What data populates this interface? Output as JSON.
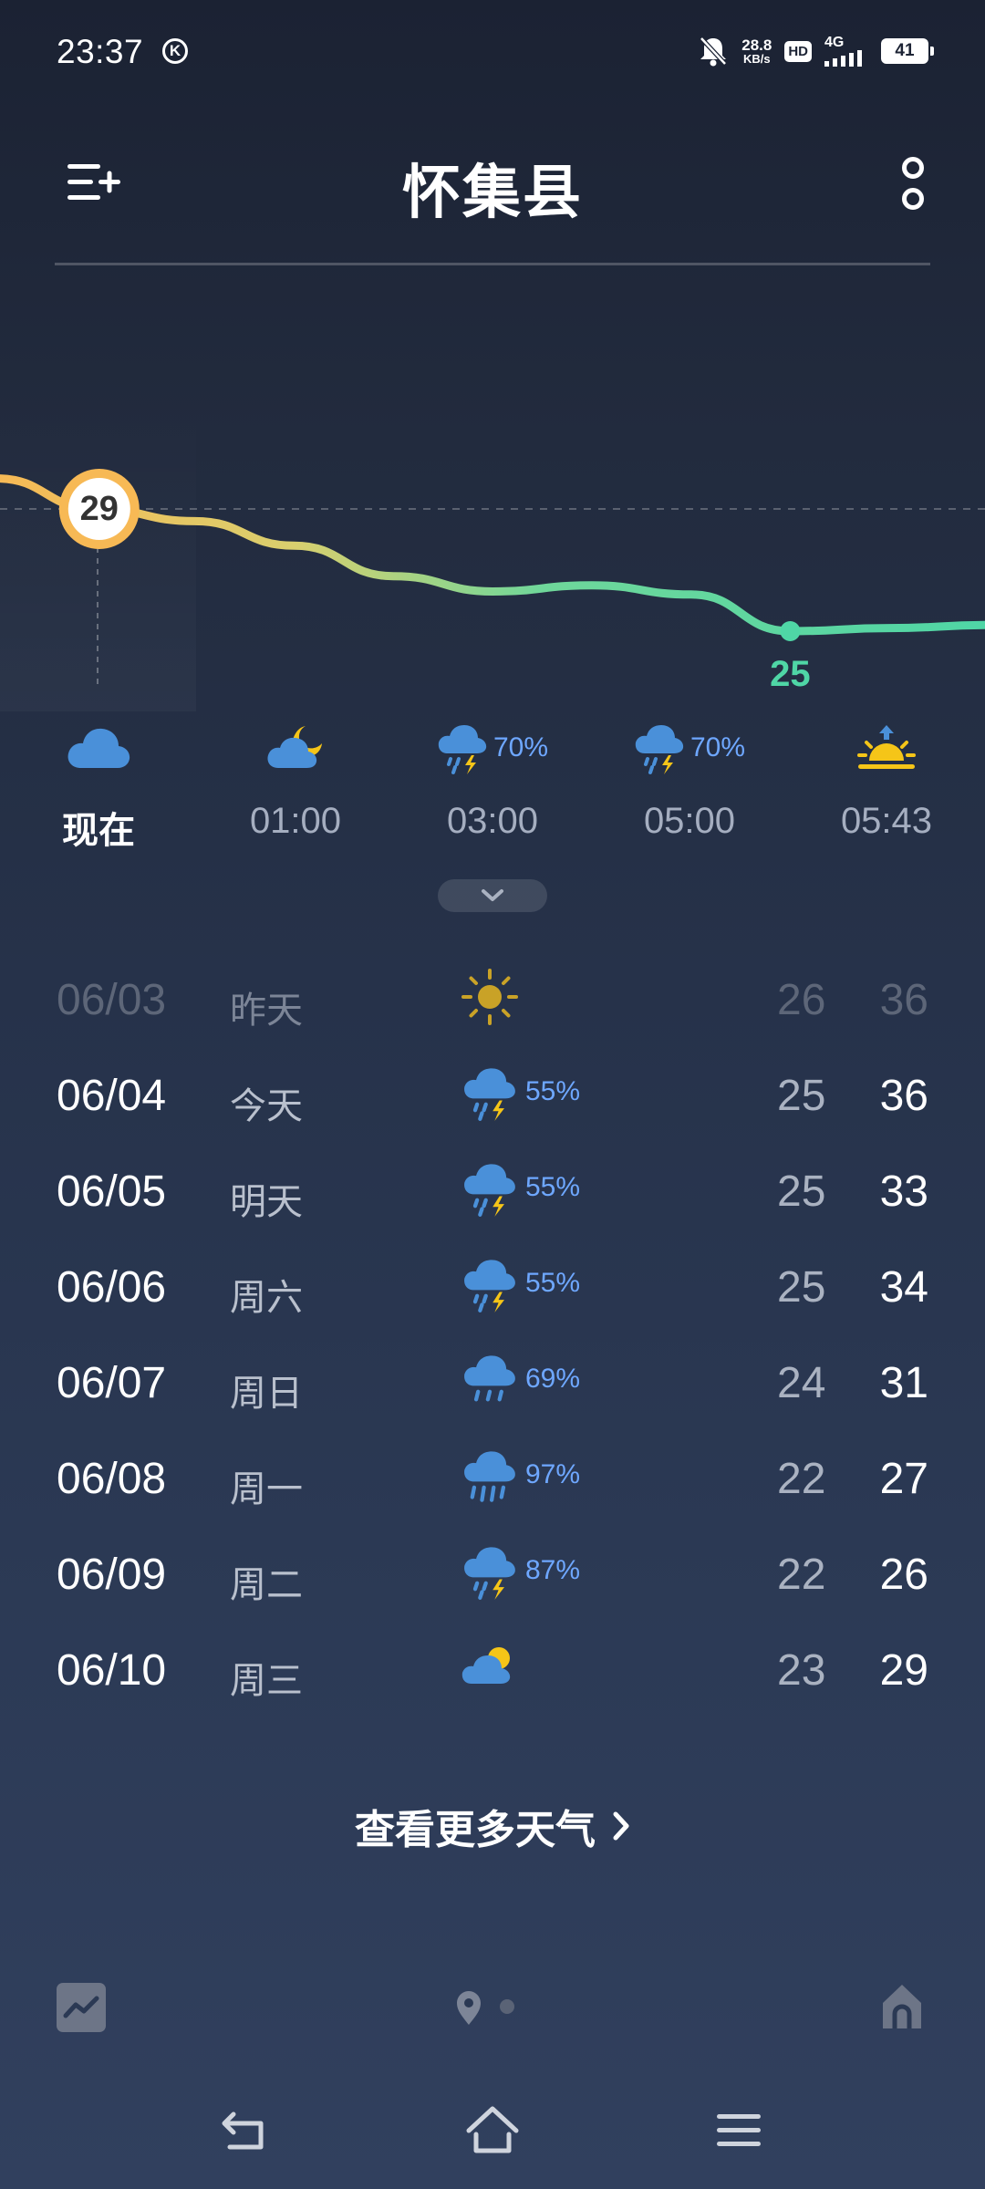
{
  "status_bar": {
    "time": "23:37",
    "k_badge": "K",
    "net_speed_value": "28.8",
    "net_speed_unit": "KB/s",
    "hd_label": "HD",
    "network_label": "4G",
    "battery_level": "41"
  },
  "header": {
    "city": "怀集县"
  },
  "chart_data": {
    "type": "line",
    "series": [
      {
        "values": [
          30,
          29,
          28.6,
          27.8,
          26.8,
          26.3,
          26.5,
          26.2,
          25,
          25.1,
          25.2
        ]
      }
    ],
    "labeled_points": [
      {
        "label": "29",
        "value": 29,
        "highlighted": true
      },
      {
        "label": "25",
        "value": 25,
        "highlighted": false
      }
    ],
    "colors": {
      "warm": "#f7b955",
      "mid": "#c9d777",
      "cool": "#57d6a2"
    },
    "grid": false
  },
  "hourly": [
    {
      "label": "现在",
      "icon": "cloudy-icon",
      "precip": ""
    },
    {
      "label": "01:00",
      "icon": "cloudy-night-icon",
      "precip": ""
    },
    {
      "label": "03:00",
      "icon": "thunder-shower-icon",
      "precip": "70%"
    },
    {
      "label": "05:00",
      "icon": "thunder-shower-icon",
      "precip": "70%"
    },
    {
      "label": "05:43",
      "icon": "sunrise-icon",
      "precip": ""
    }
  ],
  "daily": [
    {
      "date": "06/03",
      "weekday": "昨天",
      "icon": "sunny-icon",
      "precip": "",
      "low": "26",
      "high": "36"
    },
    {
      "date": "06/04",
      "weekday": "今天",
      "icon": "thunder-shower-icon",
      "precip": "55%",
      "low": "25",
      "high": "36"
    },
    {
      "date": "06/05",
      "weekday": "明天",
      "icon": "thunder-shower-icon",
      "precip": "55%",
      "low": "25",
      "high": "33"
    },
    {
      "date": "06/06",
      "weekday": "周六",
      "icon": "thunder-shower-icon",
      "precip": "55%",
      "low": "25",
      "high": "34"
    },
    {
      "date": "06/07",
      "weekday": "周日",
      "icon": "rain-icon",
      "precip": "69%",
      "low": "24",
      "high": "31"
    },
    {
      "date": "06/08",
      "weekday": "周一",
      "icon": "heavy-rain-icon",
      "precip": "97%",
      "low": "22",
      "high": "27"
    },
    {
      "date": "06/09",
      "weekday": "周二",
      "icon": "thunder-shower-icon",
      "precip": "87%",
      "low": "22",
      "high": "26"
    },
    {
      "date": "06/10",
      "weekday": "周三",
      "icon": "partly-cloudy-icon",
      "precip": "",
      "low": "23",
      "high": "29"
    }
  ],
  "more_weather_label": "查看更多天气",
  "colors": {
    "precip_blue": "#6ea7ff",
    "cloud_blue": "#4a90d9",
    "sun_yellow": "#f5c518",
    "text_muted": "#a5aec0"
  }
}
